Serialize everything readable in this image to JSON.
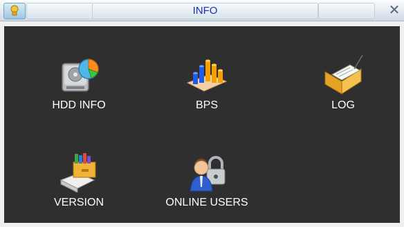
{
  "window": {
    "title": "INFO",
    "close_symbol": "✕"
  },
  "menu": {
    "items": [
      {
        "label": "HDD INFO",
        "icon": "hdd-info-icon"
      },
      {
        "label": "BPS",
        "icon": "bps-chart-icon"
      },
      {
        "label": "LOG",
        "icon": "log-folder-icon"
      },
      {
        "label": "VERSION",
        "icon": "version-drawer-icon"
      },
      {
        "label": "ONLINE USERS",
        "icon": "online-users-icon"
      }
    ]
  },
  "colors": {
    "title_text": "#1a2fb5",
    "panel_bg": "#2f2f2f",
    "label_text": "#ffffff"
  }
}
